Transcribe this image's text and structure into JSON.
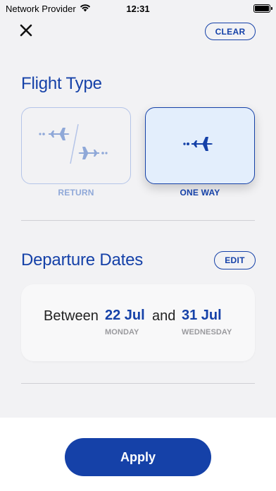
{
  "status_bar": {
    "carrier": "Network Provider",
    "time": "12:31",
    "battery_level": 1.0
  },
  "header": {
    "close_icon": "close-icon",
    "clear_label": "CLEAR"
  },
  "flight_type": {
    "title": "Flight Type",
    "options": [
      {
        "label": "RETURN",
        "icon": "return-flight-icon",
        "selected": false
      },
      {
        "label": "ONE WAY",
        "icon": "one-way-flight-icon",
        "selected": true
      }
    ]
  },
  "departure_dates": {
    "title": "Departure Dates",
    "edit_label": "EDIT",
    "between_text": "Between",
    "and_text": "and",
    "from_date": "22 Jul",
    "from_day": "MONDAY",
    "to_date": "31 Jul",
    "to_day": "WEDNESDAY"
  },
  "footer": {
    "apply_label": "Apply"
  },
  "colors": {
    "accent": "#1541a8",
    "accent_light": "#8fa8d8",
    "selected_card_bg": "#e3eefc",
    "background": "#f2f2f4"
  }
}
